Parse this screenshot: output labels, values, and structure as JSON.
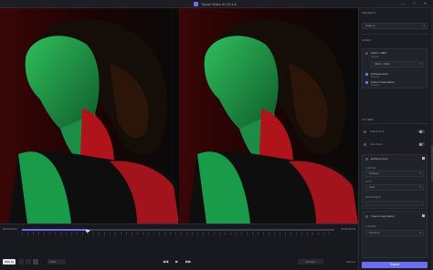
{
  "titlebar": {
    "title": "Topaz Video AI  v3.1.8",
    "minimize": "—",
    "maximize": "□",
    "close": "✕"
  },
  "timeline": {
    "current_time": "00:00:00:00",
    "end_time": "00:00:10:00",
    "progress": 0.21
  },
  "controls": {
    "view_mode": "Side by side",
    "zoom": "100%",
    "preview": "Preview",
    "frames_label": "Frames",
    "prev_icon": "◀◀",
    "play_icon": "▶",
    "next_icon": "▶▶"
  },
  "panel": {
    "presets_head": "PRESETS",
    "preset_value": "Custom",
    "video_head": "VIDEO",
    "resolution": "1920 × 1080",
    "resolution_sub": "Original",
    "output_size": "3840 × 2160",
    "enhancement_label": "Enhancement",
    "enhancement_sub": "Proteus",
    "frame_interp_label": "Frame Interpolation",
    "frame_interp_sub": "Chronos",
    "filters_head": "FILTERS",
    "stabilization_label": "Stabilization",
    "grain_label": "Add Grain",
    "enhancement2_label": "Enhancement",
    "ai_model_label": "AI MODEL",
    "ai_model_value": "Proteus",
    "auto_label": "AUTO",
    "auto_value": "Auto",
    "param_label": "PARAMETERS",
    "frame_interp2_label": "Frame Interpolation",
    "interp_model_label": "AI MODEL",
    "interp_model_value": "Chronos",
    "export_label": "Export"
  }
}
